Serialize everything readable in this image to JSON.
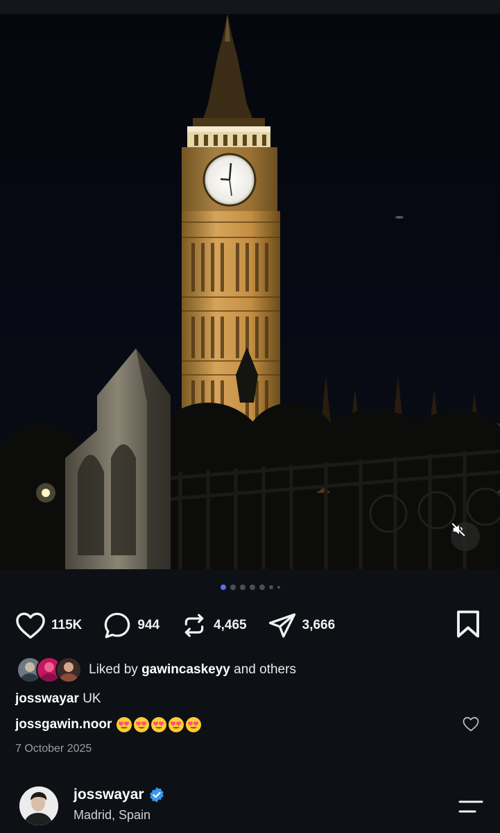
{
  "post": {
    "photo_alt": "",
    "carousel": {
      "count": 7,
      "active_index": 0
    }
  },
  "actions": {
    "likes": "115K",
    "comments": "944",
    "reposts": "4,465",
    "shares": "3,666"
  },
  "liked_by": {
    "prefix": "Liked by",
    "user": "gawincaskeyy",
    "suffix": "and others"
  },
  "caption": {
    "username": "josswayar",
    "text": "UK"
  },
  "comment": {
    "username": "jossgawin.noor",
    "emoji_count": 5
  },
  "date": "7 October 2025",
  "author": {
    "username": "josswayar",
    "verified": true,
    "location": "Madrid, Spain"
  },
  "icons": {
    "like": "heart-icon",
    "comment": "comment-bubble-icon",
    "repost": "repost-icon",
    "share": "send-icon",
    "save": "bookmark-icon",
    "mute": "speaker-muted-icon",
    "menu": "menu-icon"
  },
  "colors": {
    "background": "#0d1014",
    "active_dot": "#5a6cf0",
    "verified_badge": "#3897f0",
    "heart_emoji": "#ff4f7a"
  }
}
